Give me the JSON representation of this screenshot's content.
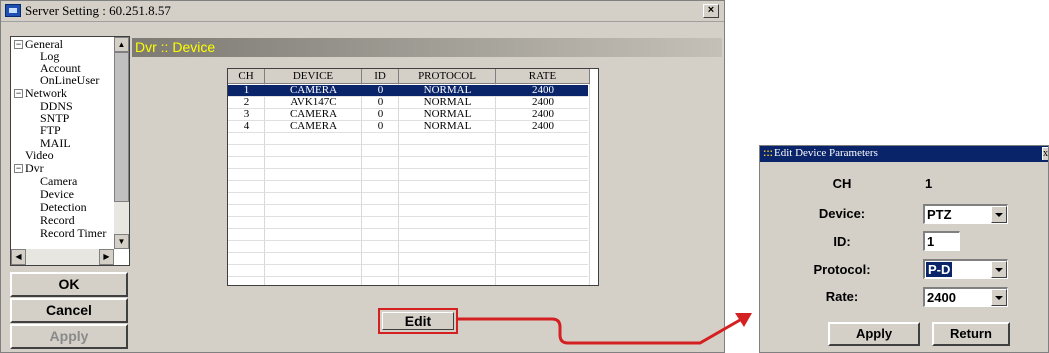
{
  "window": {
    "title": "Server Setting : 60.251.8.57",
    "close_glyph": "×"
  },
  "tree": {
    "items": [
      {
        "label": "General",
        "expander": "−"
      },
      {
        "label": "Log"
      },
      {
        "label": "Account"
      },
      {
        "label": "OnLineUser"
      },
      {
        "label": "Network",
        "expander": "−"
      },
      {
        "label": "DDNS"
      },
      {
        "label": "SNTP"
      },
      {
        "label": "FTP"
      },
      {
        "label": "MAIL"
      },
      {
        "label": "Video"
      },
      {
        "label": "Dvr",
        "expander": "−"
      },
      {
        "label": "Camera"
      },
      {
        "label": "Device"
      },
      {
        "label": "Detection"
      },
      {
        "label": "Record"
      },
      {
        "label": "Record Timer"
      }
    ]
  },
  "buttons": {
    "ok": "OK",
    "cancel": "Cancel",
    "apply": "Apply"
  },
  "panel": {
    "header": "Dvr :: Device"
  },
  "table": {
    "columns": [
      "CH",
      "DEVICE",
      "ID",
      "PROTOCOL",
      "RATE"
    ],
    "rows": [
      [
        "1",
        "CAMERA",
        "0",
        "NORMAL",
        "2400"
      ],
      [
        "2",
        "AVK147C",
        "0",
        "NORMAL",
        "2400"
      ],
      [
        "3",
        "CAMERA",
        "0",
        "NORMAL",
        "2400"
      ],
      [
        "4",
        "CAMERA",
        "0",
        "NORMAL",
        "2400"
      ]
    ],
    "selected_row": 0
  },
  "edit_button": "Edit",
  "dialog": {
    "title": "Edit Device Parameters",
    "title_icon": ":::",
    "close_glyph": "x",
    "ch_label": "CH",
    "ch_value": "1",
    "device_label": "Device:",
    "device_value": "PTZ",
    "id_label": "ID:",
    "id_value": "1",
    "protocol_label": "Protocol:",
    "protocol_value": "P-D",
    "rate_label": "Rate:",
    "rate_value": "2400",
    "apply_label": "Apply",
    "return_label": "Return"
  },
  "colors": {
    "accent_red": "#d42020",
    "header_text": "#ffff00",
    "selection": "#0a246a"
  }
}
